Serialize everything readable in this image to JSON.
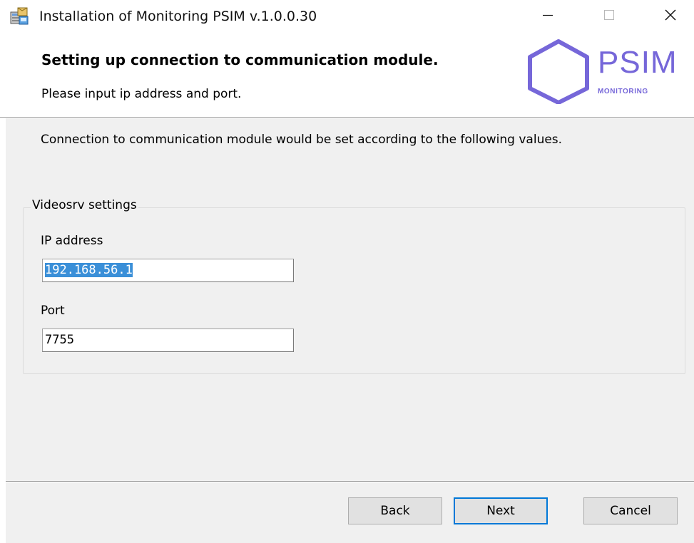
{
  "window": {
    "title": "Installation of Monitoring PSIM v.1.0.0.30",
    "app_icon": "installer-package-icon",
    "controls": {
      "minimize": "minimize-icon",
      "maximize": "maximize-icon",
      "close": "close-icon"
    }
  },
  "header": {
    "title": "Setting up connection to communication module.",
    "subtitle": "Please input ip address and port.",
    "logo": {
      "name": "PSIM",
      "tagline": "MONITORING",
      "color": "#7667d9"
    }
  },
  "main": {
    "description": "Connection to communication module would be set according to the following values.",
    "group": {
      "legend": "Videosrv settings",
      "fields": [
        {
          "label": "IP address",
          "value": "192.168.56.1",
          "selected": true
        },
        {
          "label": "Port",
          "value": "7755",
          "selected": false
        }
      ]
    }
  },
  "buttons": {
    "back": "Back",
    "next": "Next",
    "cancel": "Cancel"
  },
  "colors": {
    "accent": "#0078d7",
    "selection": "#3a8fd8",
    "panel": "#f0f0f0"
  }
}
